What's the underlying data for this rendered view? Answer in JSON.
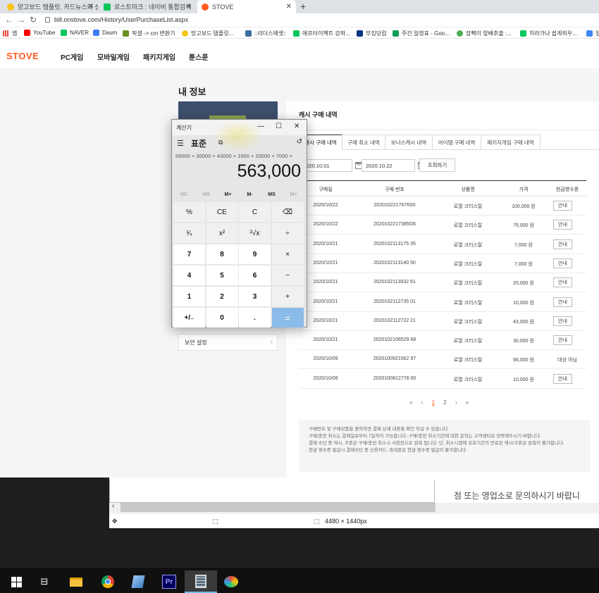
{
  "browser": {
    "tabs": [
      {
        "title": "망고보드 템플릿, 카드뉴스와 상",
        "fav_color": "#f5c518"
      },
      {
        "title": "로스트마크 : 네이버 통합검색",
        "fav_color": "#03c75a"
      },
      {
        "title": "STOVE",
        "fav_color": "#ff5a1f"
      }
    ],
    "url": "bill.onstove.com/History/UserPurchaseList.aspx",
    "bookmarks": [
      {
        "label": "앱",
        "color": "#4285f4"
      },
      {
        "label": "YouTube",
        "color": "#ff0000"
      },
      {
        "label": "NAVER",
        "color": "#03c75a"
      },
      {
        "label": "Daum",
        "color": "#3d7cf3"
      },
      {
        "label": "픽셀 -> cm 변환기",
        "color": "#6b8e23"
      },
      {
        "label": "망고보드 템플릿...",
        "color": "#f5c518"
      },
      {
        "label": "::리더스에셋::",
        "color": "#3a6ea5"
      },
      {
        "label": "애프터이펙트 강좌...",
        "color": "#03c75a"
      },
      {
        "label": "부킹닷컴",
        "color": "#003580"
      },
      {
        "label": "주간 일정표 - Goo...",
        "color": "#0f9d58"
      },
      {
        "label": "잡빡이 앞배추출 :...",
        "color": "#4caf50"
      },
      {
        "label": "히라가나 쉽게외우...",
        "color": "#03c75a"
      },
      {
        "label": "일",
        "color": "#4285f4"
      }
    ]
  },
  "site": {
    "logo": "STOVE",
    "nav": [
      "PC게임",
      "모바일게임",
      "패키지게임",
      "툰스푼"
    ],
    "my_info_title": "내 정보",
    "left_menu_item": "보안 설정"
  },
  "panel": {
    "title": "캐시 구매 내역",
    "tabs": [
      "캐시 구매 내역",
      "구매 취소 내역",
      "보너스캐시 내역",
      "아이템 구매 내역",
      "패키지게임 구매 내역"
    ],
    "date_from": "2020.10.01",
    "date_to": "2020.10.22",
    "search_label": "조회하기",
    "columns": [
      "구매일",
      "구매 번호",
      "상품명",
      "가격",
      "현금영수증"
    ],
    "rows": [
      {
        "date": "2020/10/22",
        "no": "2020102217676S0",
        "item": "로열 크리스탈",
        "price": "100,000 원",
        "receipt": "안내"
      },
      {
        "date": "2020/10/22",
        "no": "2020102217385O6",
        "item": "로열 크리스탈",
        "price": "75,000 원",
        "receipt": "안내"
      },
      {
        "date": "2020/10/21",
        "no": "2020102113175 35",
        "item": "로열 크리스탈",
        "price": "7,000 원",
        "receipt": "안내"
      },
      {
        "date": "2020/10/21",
        "no": "2020102113140 50",
        "item": "로열 크리스탈",
        "price": "7,000 원",
        "receipt": "안내"
      },
      {
        "date": "2020/10/21",
        "no": "2020102113032 61",
        "item": "로열 크리스탈",
        "price": "20,000 원",
        "receipt": "안내"
      },
      {
        "date": "2020/10/21",
        "no": "2020102112735 01",
        "item": "로열 크리스탈",
        "price": "10,000 원",
        "receipt": "안내"
      },
      {
        "date": "2020/10/21",
        "no": "2020102112722 21",
        "item": "로열 크리스탈",
        "price": "43,000 원",
        "receipt": "안내"
      },
      {
        "date": "2020/10/21",
        "no": "2020102106529 68",
        "item": "로열 크리스탈",
        "price": "30,000 원",
        "receipt": "안내"
      },
      {
        "date": "2020/10/09",
        "no": "2020100921562 97",
        "item": "로열 크리스탈",
        "price": "66,000 원",
        "receipt": "대상 아님"
      },
      {
        "date": "2020/10/08",
        "no": "2020100812778 00",
        "item": "로열 크리스탈",
        "price": "10,000 원",
        "receipt": "안내"
      }
    ],
    "pager": [
      "«",
      "‹",
      "1",
      "2",
      "›",
      "»"
    ],
    "notes": [
      "· 구매번호 및 구매상품을 클릭하면 결제 상세 내용을 확인 하실 수 있습니다.",
      "· 구매/충전 취소는 결제일로부터 7일까지 가능합니다. 구매/충전 취소기간에 대한 문의는 고객센터로 연락해주시기 바랍니다.",
      "· 결제 수단 중 캐시, 쿠폰은 구매/충전 취소시 사용전으로 원복 됩니다. 단, 취소시점에 유효기간이 만료된 캐시/쿠폰은 원복이 불가합니다.",
      "· 현금 영수증 발급시 결제수단 중 신용카드, 휴대폰은 현금 영수증 발급이 불가합니다."
    ]
  },
  "calculator": {
    "title": "계산기",
    "mode": "표준",
    "expression": "56000 + 30000 + 43000 + 1000 + 20000 + 7000 +",
    "display": "563,000",
    "memory": [
      "MC",
      "MR",
      "M+",
      "M-",
      "MS",
      "M˅"
    ],
    "keys": [
      [
        "%",
        "CE",
        "C",
        "⌫"
      ],
      [
        "¹⁄ₓ",
        "x²",
        "²√x",
        "÷"
      ],
      [
        "7",
        "8",
        "9",
        "×"
      ],
      [
        "4",
        "5",
        "6",
        "−"
      ],
      [
        "1",
        "2",
        "3",
        "+"
      ],
      [
        "+/₋",
        "0",
        ".",
        "="
      ]
    ]
  },
  "viewer": {
    "side_text": "점 또는 영업소로 문의하시기 바랍니",
    "dimensions": "4480 × 1440px"
  },
  "taskbar": {
    "apps": [
      "start",
      "task-view",
      "file-explorer",
      "chrome",
      "notepad",
      "premiere-pro",
      "calculator",
      "paint"
    ],
    "active": "calculator"
  }
}
